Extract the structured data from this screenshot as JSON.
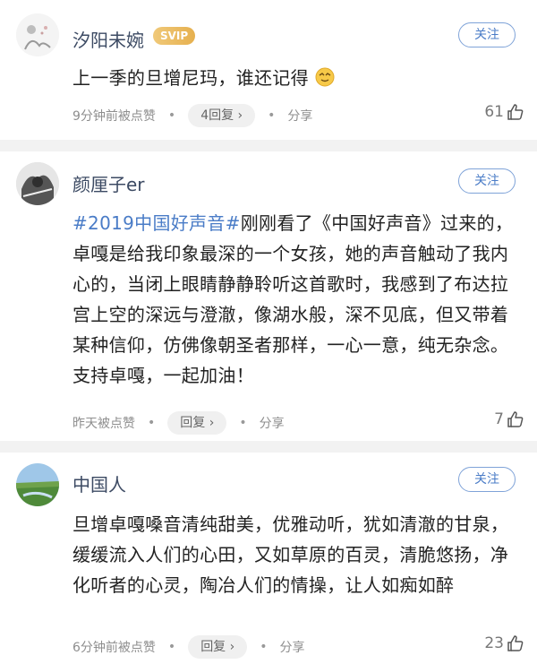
{
  "comments": [
    {
      "username": "汐阳未婉",
      "badge": "SVIP",
      "follow_label": "关注",
      "text_plain": "上一季的旦增尼玛，谁还记得",
      "time_text": "9分钟前被点赞",
      "reply_label": "4回复 ›",
      "share_label": "分享",
      "likes": "61"
    },
    {
      "username": "颜厘子er",
      "follow_label": "关注",
      "hashtag": "#2019中国好声音#",
      "text_rest": "刚刚看了《中国好声音》过来的，卓嘎是给我印象最深的一个女孩，她的声音触动了我内心的，当闭上眼睛静静聆听这首歌时，我感到了布达拉宫上空的深远与澄澈，像湖水般，深不见底，但又带着某种信仰，仿佛像朝圣者那样，一心一意，纯无杂念。支持卓嘎，一起加油！",
      "time_text": "昨天被点赞",
      "reply_label": "回复 ›",
      "share_label": "分享",
      "likes": "7"
    },
    {
      "username": "中国人",
      "follow_label": "关注",
      "text_plain": "旦增卓嘎嗓音清纯甜美，优雅动听，犹如清澈的甘泉，缓缓流入人们的心田，又如草原的百灵，清脆悠扬，净化听者的心灵，陶冶人们的情操，让人如痴如醉",
      "time_text": "6分钟前被点赞",
      "reply_label": "回复 ›",
      "share_label": "分享",
      "likes": "23"
    }
  ],
  "colors": {
    "username": "#3c4a63",
    "hashtag": "#4a7cc7",
    "follow_border": "#7fa3d8",
    "svip_gold": "#e6b04f",
    "separator": "#f2f2f2"
  },
  "icons": [
    "thumbs-up-icon",
    "emoji-icon",
    "chevron-right-icon"
  ]
}
